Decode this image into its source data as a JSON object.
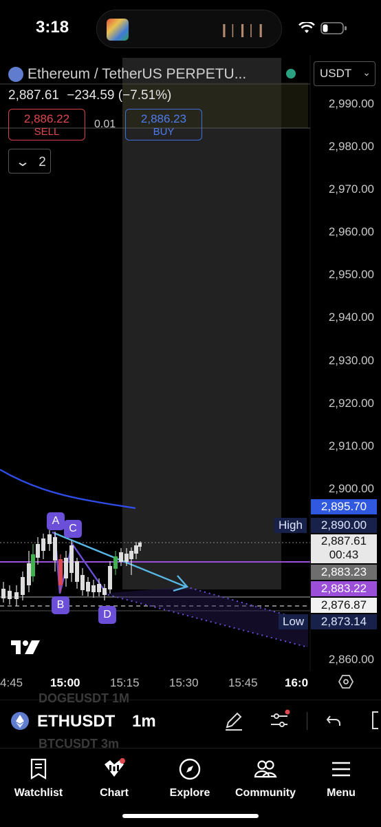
{
  "status_bar": {
    "time": "3:18"
  },
  "symbol_header": {
    "title": "Ethereum / TetherUS PERPETU...",
    "currency": "USDT",
    "last_price": "2,887.61",
    "change": "−234.59 (−7.51%)",
    "sell_price": "2,886.22",
    "sell_label": "SELL",
    "buy_price": "2,886.23",
    "buy_label": "BUY",
    "spread": "0.01",
    "collapse_count": "2"
  },
  "price_axis": {
    "labels": [
      "2,990.00",
      "2,980.00",
      "2,970.00",
      "2,960.00",
      "2,950.00",
      "2,940.00",
      "2,930.00",
      "2,920.00",
      "2,910.00",
      "2,900.00",
      "2,860.00"
    ],
    "tags": {
      "ma_value": "2,895.70",
      "high_label": "High",
      "high_value": "2,890.00",
      "current_price": "2,887.61",
      "countdown": "00:43",
      "level_a": "2,883.23",
      "level_b": "2,883.22",
      "level_c": "2,876.87",
      "low_label": "Low",
      "low_value": "2,873.14"
    }
  },
  "pattern_points": [
    "A",
    "B",
    "C",
    "D"
  ],
  "time_axis": [
    "4:45",
    "15:00",
    "15:15",
    "15:30",
    "15:45",
    "16:0"
  ],
  "toolbar": {
    "symbol": "ETHUSDT",
    "interval": "1m",
    "ghost_above": "DOGEUSDT  1M",
    "ghost_below": "BTCUSDT  3m"
  },
  "tabs": [
    {
      "label": "Watchlist",
      "icon": "watchlist-icon"
    },
    {
      "label": "Chart",
      "icon": "chart-icon"
    },
    {
      "label": "Explore",
      "icon": "compass-icon"
    },
    {
      "label": "Community",
      "icon": "community-icon"
    },
    {
      "label": "Menu",
      "icon": "menu-icon"
    }
  ],
  "colors": {
    "ma_line": "#2f4de8",
    "buy": "#3f6fe0",
    "sell": "#d9424c",
    "pattern": "#6b4fd8",
    "level_purple": "#9b4fd8",
    "trend_line": "#58b8e6"
  }
}
